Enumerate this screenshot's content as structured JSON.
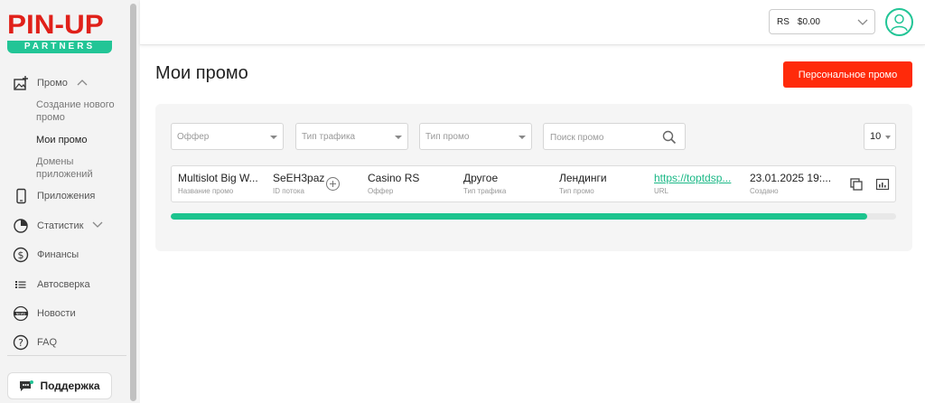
{
  "brand": {
    "word": "PIN-UP",
    "sub": "PARTNERS",
    "red": "#e02019",
    "green": "#22c596"
  },
  "sidebar": {
    "promo": {
      "label": "Промо",
      "icon": "add-image-icon"
    },
    "promo_sub": [
      "Создание нового промо",
      "Мои промо",
      "Домены приложений"
    ],
    "items": [
      {
        "label": "Приложения",
        "icon": "phone-icon"
      },
      {
        "label": "Статистик",
        "icon": "pie-chart-icon"
      },
      {
        "label": "Финансы",
        "icon": "dollar-icon"
      },
      {
        "label": "Автосверка",
        "icon": "list-icon"
      },
      {
        "label": "Новости",
        "icon": "news-icon"
      },
      {
        "label": "FAQ",
        "icon": "question-icon"
      }
    ],
    "support": {
      "label": "Поддержка",
      "icon": "chat-icon"
    }
  },
  "header": {
    "currency": "RS",
    "balance": "$0.00"
  },
  "main": {
    "title": "Мои промо",
    "personal_button": "Персональное промо",
    "filters": {
      "offer": "Оффер",
      "traffic_type": "Тип трафика",
      "promo_type": "Тип промо",
      "search_placeholder": "Поиск промо",
      "per_page": "10"
    },
    "row": {
      "name": {
        "value": "Multislot Big W...",
        "label": "Название промо"
      },
      "stream": {
        "value": "SeEH3paz",
        "label": "ID потока"
      },
      "offer": {
        "value": "Casino RS",
        "label": "Оффер"
      },
      "traffic": {
        "value": "Другое",
        "label": "Тип трафика"
      },
      "promo_type": {
        "value": "Лендинги",
        "label": "Тип промо"
      },
      "url": {
        "value": "https://toptdsp...",
        "label": "URL"
      },
      "created": {
        "value": "23.01.2025 19:...",
        "label": "Создано"
      }
    },
    "progress": 0.96,
    "accent": "#ff2a0a"
  }
}
